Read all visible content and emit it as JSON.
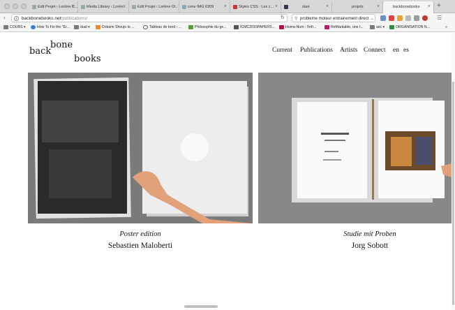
{
  "browser": {
    "tabs": [
      {
        "label": "Edit Projet ‹ Lorène C..."
      },
      {
        "label": "Media Library ‹ Lorèn..."
      },
      {
        "label": "Edit Projet ‹ Lorène C..."
      },
      {
        "label": "conv IMG 0309"
      },
      {
        "label": "Styles CSS : Les c..."
      },
      {
        "label": "start"
      },
      {
        "label": "projets"
      },
      {
        "label": "backbonebooks"
      }
    ],
    "url_host": "backbonebooks.net",
    "url_path": "/publications/",
    "search_value": "probleme moteur entrainement direct →",
    "bookmarks": [
      {
        "label": "COURS ▾"
      },
      {
        "label": "How To Fix the \"Er..."
      },
      {
        "label": "dual ▾"
      },
      {
        "label": "Dokami Shoujo to ..."
      },
      {
        "label": "Tableau de bord ‹ ..."
      },
      {
        "label": "Philosophie du ge..."
      },
      {
        "label": "ICMC2016PAPERS..."
      },
      {
        "label": "Huma-Num : l'infr..."
      },
      {
        "label": "ReMarkable, une t..."
      },
      {
        "label": "asc ▾"
      },
      {
        "label": "ORGANISATION N..."
      }
    ]
  },
  "site": {
    "logo": {
      "word1": "back",
      "word2": "bone",
      "word3": "books"
    },
    "menu": {
      "current": "Current",
      "publications": "Publications",
      "artists": "Artists",
      "connect": "Connect",
      "lang_en": "en",
      "lang_es": "es"
    },
    "publications": [
      {
        "title": "Poster edition",
        "artist": "Sebastien Maloberti"
      },
      {
        "title": "Studie mit Proben",
        "artist": "Jorg Sobott"
      }
    ]
  },
  "colors": {
    "panel_bg": "#777777",
    "accent": "#f5f5f5"
  }
}
